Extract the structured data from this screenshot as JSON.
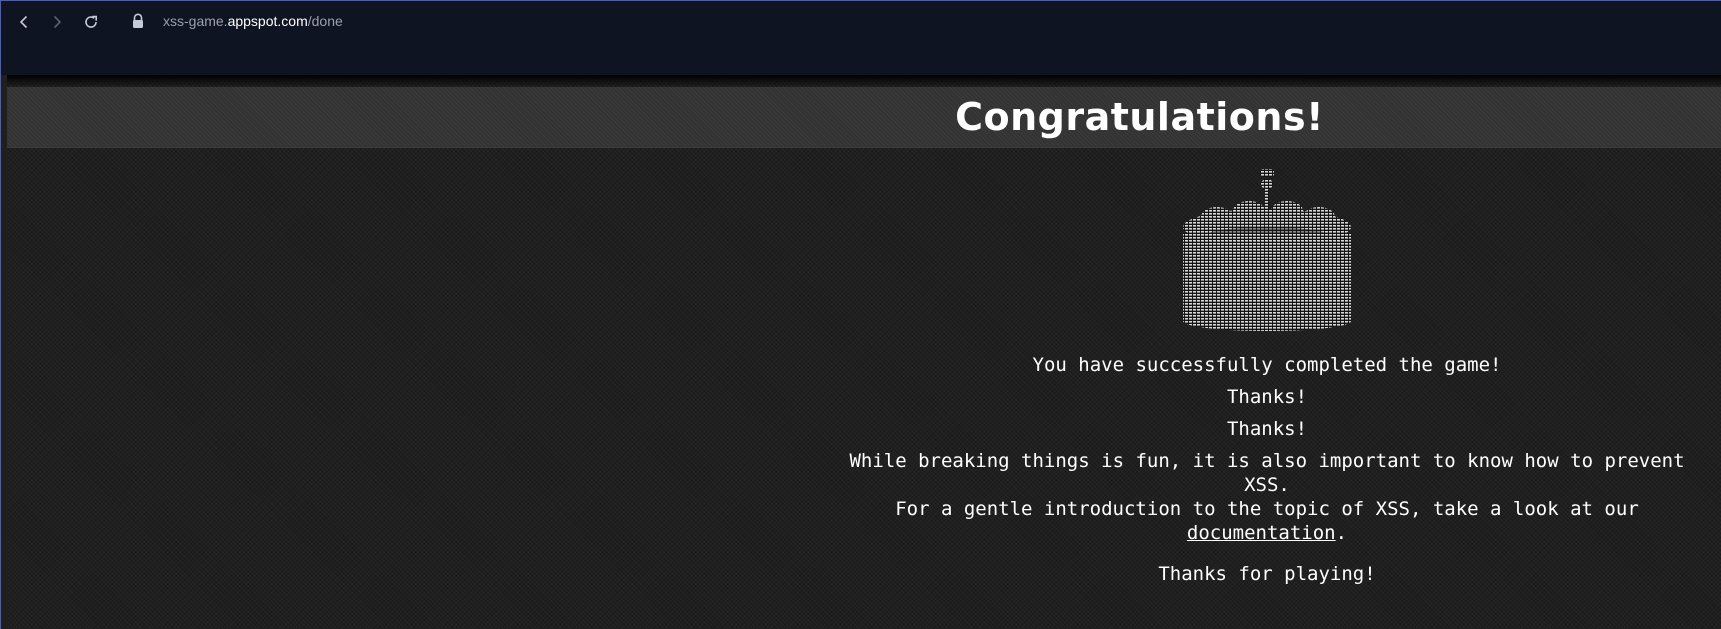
{
  "browser": {
    "url_subdomain": "xss-game.",
    "url_host": "appspot.com",
    "url_path": "/done",
    "icons": [
      "back-icon",
      "forward-icon",
      "reload-icon",
      "lock-icon"
    ]
  },
  "page": {
    "title": "Congratulations!",
    "message": "You have successfully completed the game!",
    "thanks_1": "Thanks!",
    "thanks_2": "Thanks!",
    "prevent_text": "While breaking things is fun, it is also important to know how to prevent XSS.",
    "intro_text": "For a gentle introduction to the topic of XSS, take a look at our ",
    "doc_link_label": "documentation",
    "intro_end": ".",
    "final_text": "Thanks for playing!",
    "image": "cake-image"
  },
  "colors": {
    "browser_bar": "#0e1422",
    "title_band": "#333333",
    "page_background": "#1f1f1f",
    "text": "#ffffff"
  }
}
